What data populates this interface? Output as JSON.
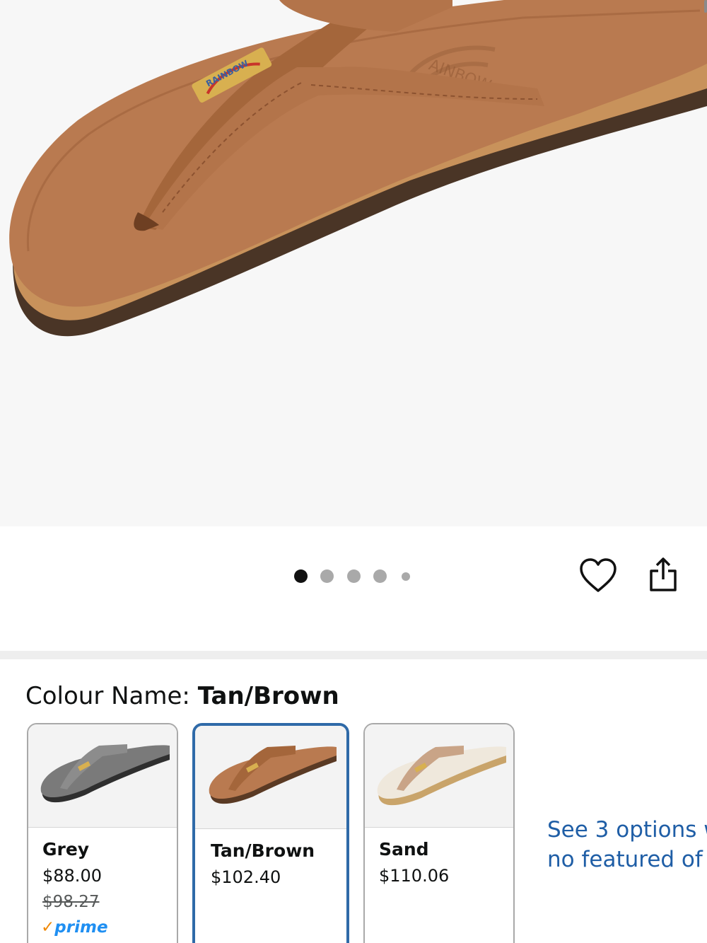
{
  "gallery": {
    "image_icon": "tan-brown-flip-flop-sandal-photo",
    "dot_count": 5,
    "active_dot": 0
  },
  "actions": {
    "wishlist_icon": "heart-outline-icon",
    "share_icon": "share-icon"
  },
  "colour": {
    "label": "Colour Name:",
    "selected": "Tan/Brown"
  },
  "swatches": [
    {
      "name": "Grey",
      "price": "$88.00",
      "list_price": "$98.27",
      "prime": "prime",
      "selected": false
    },
    {
      "name": "Tan/Brown",
      "price": "$102.40",
      "selected": true
    },
    {
      "name": "Sand",
      "price": "$110.06",
      "selected": false
    }
  ],
  "see_options": {
    "line1": "See 3 options w",
    "line2": "no featured of"
  },
  "colors": {
    "link": "#1f5ea6",
    "selected_border": "#2f6aa8",
    "prime_blue": "#1f8ff2",
    "prime_check": "#f08804"
  }
}
